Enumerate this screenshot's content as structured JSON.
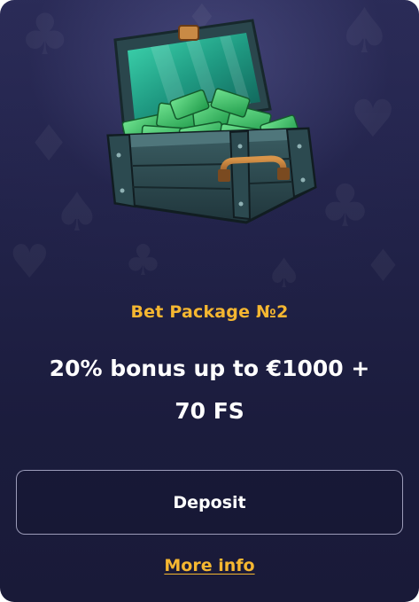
{
  "card": {
    "image": {
      "icon": "treasure-chest-with-cash-icon"
    },
    "title": "Bet Package №2",
    "bonus_line1": "20% bonus up to €1000 +",
    "bonus_line2": "70 FS",
    "deposit_label": "Deposit",
    "more_info_label": "More info"
  },
  "colors": {
    "accent": "#f5b731",
    "text": "#ffffff",
    "background": "#20214a",
    "button_border": "#c8c8e6"
  }
}
